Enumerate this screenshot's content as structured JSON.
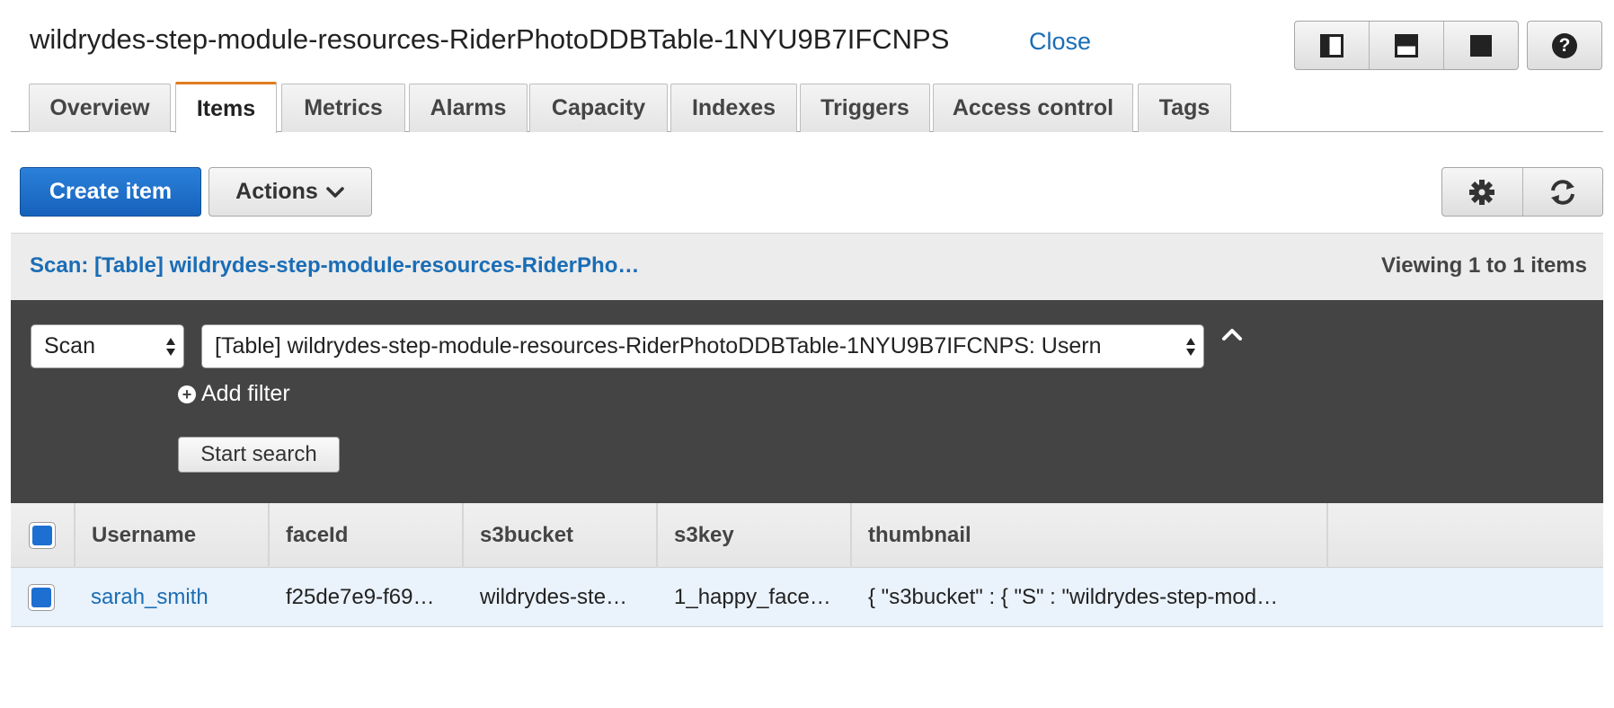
{
  "header": {
    "title": "wildrydes-step-module-resources-RiderPhotoDDBTable-1NYU9B7IFCNPS",
    "close_label": "Close"
  },
  "tabs": [
    {
      "label": "Overview"
    },
    {
      "label": "Items"
    },
    {
      "label": "Metrics"
    },
    {
      "label": "Alarms"
    },
    {
      "label": "Capacity"
    },
    {
      "label": "Indexes"
    },
    {
      "label": "Triggers"
    },
    {
      "label": "Access control"
    },
    {
      "label": "Tags"
    }
  ],
  "active_tab": "Items",
  "toolbar": {
    "create_label": "Create item",
    "actions_label": "Actions"
  },
  "scan_bar": {
    "summary": "Scan: [Table] wildrydes-step-module-resources-RiderPho…",
    "viewing": "Viewing 1 to 1 items"
  },
  "query": {
    "mode": "Scan",
    "table": "[Table] wildrydes-step-module-resources-RiderPhotoDDBTable-1NYU9B7IFCNPS: Usern",
    "add_filter_label": "Add filter",
    "start_search_label": "Start search"
  },
  "grid": {
    "columns": [
      "Username",
      "faceId",
      "s3bucket",
      "s3key",
      "thumbnail"
    ],
    "rows": [
      {
        "Username": "sarah_smith",
        "faceId": "f25de7e9-f69…",
        "s3bucket": "wildrydes-ste…",
        "s3key": "1_happy_face…",
        "thumbnail": "{ \"s3bucket\" : { \"S\" : \"wildrydes-step-mod…"
      }
    ]
  },
  "colors": {
    "primary": "#1662bb",
    "link": "#1a6db5",
    "active_tab_accent": "#e07b1f",
    "panel_dark": "#444444",
    "row_selected": "#eaf2fb"
  }
}
